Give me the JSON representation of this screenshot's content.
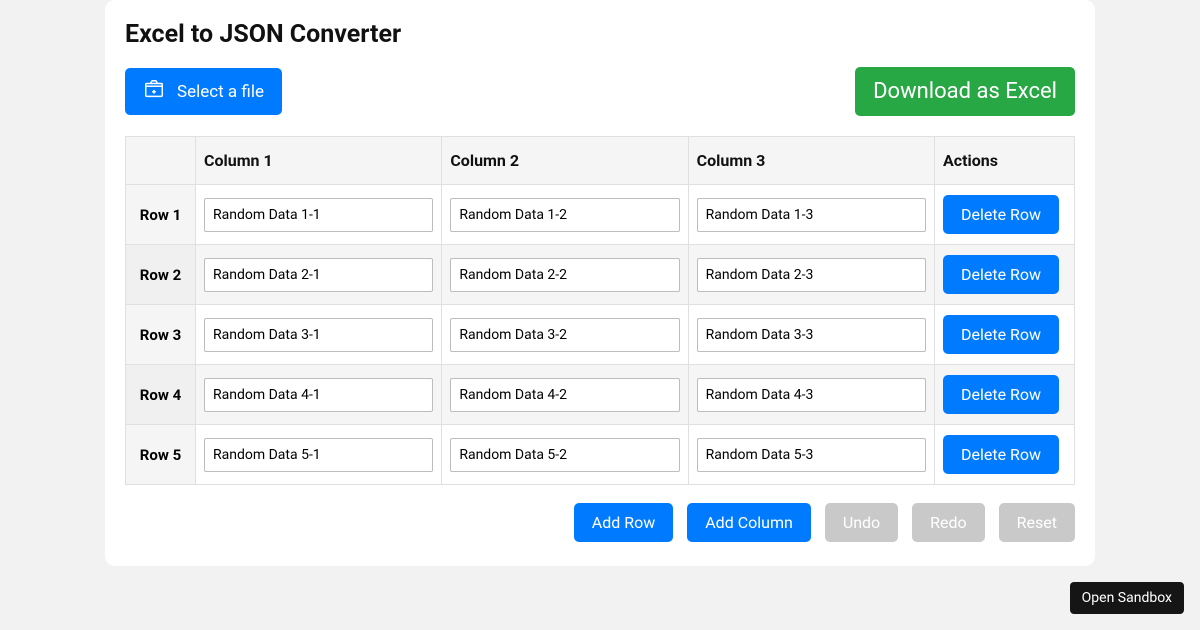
{
  "title": "Excel to JSON Converter",
  "toolbar": {
    "select_file_label": "Select a file",
    "download_label": "Download as Excel"
  },
  "table": {
    "headers": {
      "col1": "Column 1",
      "col2": "Column 2",
      "col3": "Column 3",
      "actions": "Actions"
    },
    "row_labels": [
      "Row 1",
      "Row 2",
      "Row 3",
      "Row 4",
      "Row 5"
    ],
    "rows": [
      {
        "c1": "Random Data 1-1",
        "c2": "Random Data 1-2",
        "c3": "Random Data 1-3"
      },
      {
        "c1": "Random Data 2-1",
        "c2": "Random Data 2-2",
        "c3": "Random Data 2-3"
      },
      {
        "c1": "Random Data 3-1",
        "c2": "Random Data 3-2",
        "c3": "Random Data 3-3"
      },
      {
        "c1": "Random Data 4-1",
        "c2": "Random Data 4-2",
        "c3": "Random Data 4-3"
      },
      {
        "c1": "Random Data 5-1",
        "c2": "Random Data 5-2",
        "c3": "Random Data 5-3"
      }
    ],
    "delete_label": "Delete Row"
  },
  "footer": {
    "add_row": "Add Row",
    "add_column": "Add Column",
    "undo": "Undo",
    "redo": "Redo",
    "reset": "Reset"
  },
  "sandbox_label": "Open Sandbox"
}
